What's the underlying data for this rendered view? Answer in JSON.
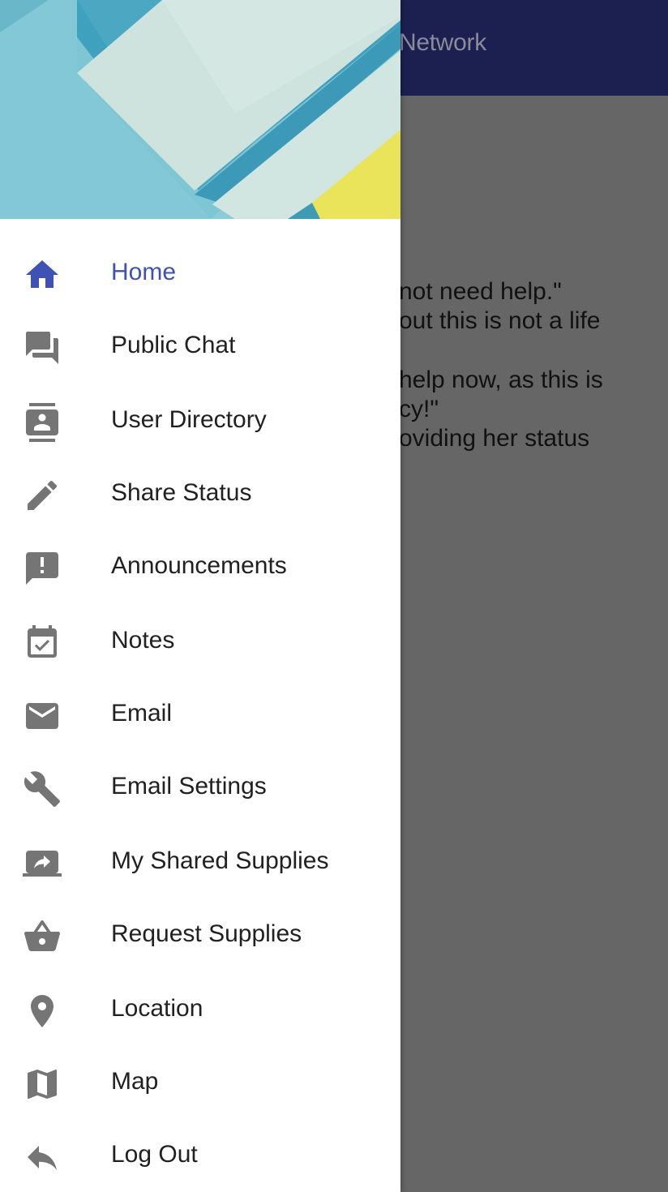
{
  "app": {
    "title": "Network",
    "content_lines": [
      "not need help.\"",
      "out this is not a life",
      " help now, as this is",
      "cy!\"",
      "oviding her status"
    ]
  },
  "colors": {
    "app_bar": "#1b2050",
    "active": "#3f51b5",
    "icon": "#757575",
    "scrim": "#666666"
  },
  "drawer": {
    "header_image": "material-paper-pattern",
    "items": [
      {
        "label": "Home",
        "icon": "home-icon",
        "active": true
      },
      {
        "label": "Public Chat",
        "icon": "forum-icon",
        "active": false
      },
      {
        "label": "User Directory",
        "icon": "contacts-icon",
        "active": false
      },
      {
        "label": "Share Status",
        "icon": "pencil-icon",
        "active": false
      },
      {
        "label": "Announcements",
        "icon": "announcement-icon",
        "active": false
      },
      {
        "label": "Notes",
        "icon": "calendar-check-icon",
        "active": false
      },
      {
        "label": "Email",
        "icon": "mail-icon",
        "active": false
      },
      {
        "label": "Email Settings",
        "icon": "wrench-icon",
        "active": false
      },
      {
        "label": "My Shared Supplies",
        "icon": "screen-share-icon",
        "active": false
      },
      {
        "label": "Request Supplies",
        "icon": "basket-icon",
        "active": false
      },
      {
        "label": "Location",
        "icon": "location-pin-icon",
        "active": false
      },
      {
        "label": "Map",
        "icon": "map-icon",
        "active": false
      },
      {
        "label": "Log Out",
        "icon": "reply-icon",
        "active": false
      }
    ]
  }
}
